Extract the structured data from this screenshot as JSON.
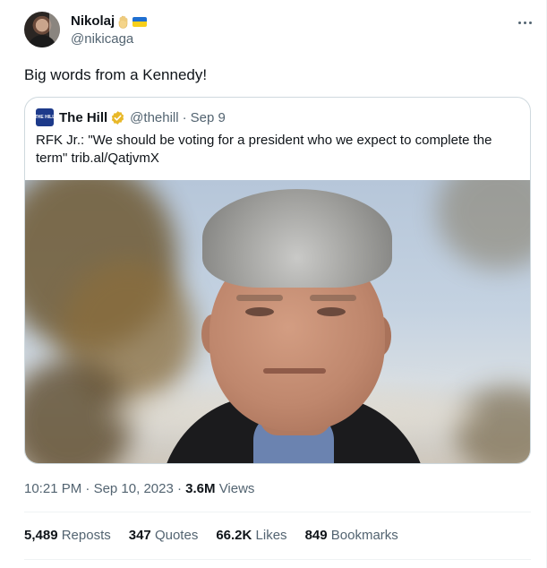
{
  "author": {
    "display_name": "Nikolaj",
    "handle": "@nikicaga"
  },
  "tweet": {
    "text": "Big words from a Kennedy!"
  },
  "quoted_tweet": {
    "logo_text": "THE HILL",
    "name": "The Hill",
    "handle": "@thehill",
    "separator": "·",
    "date": "Sep 9",
    "text": "RFK Jr.: \"We should be voting for a president who we expect to complete the term\" trib.al/QatjvmX"
  },
  "meta": {
    "time": "10:21 PM",
    "separator": "·",
    "date": "Sep 10, 2023",
    "views_count": "3.6M",
    "views_label": "Views"
  },
  "stats": [
    {
      "count": "5,489",
      "label": "Reposts"
    },
    {
      "count": "347",
      "label": "Quotes"
    },
    {
      "count": "66.2K",
      "label": "Likes"
    },
    {
      "count": "849",
      "label": "Bookmarks"
    }
  ],
  "colors": {
    "verified_gold": "#e8b829",
    "secondary_text": "#536471",
    "flag_blue": "#1f6fd1",
    "flag_yellow": "#f7cf1b"
  },
  "icons": {
    "more": "more-icon",
    "verified": "verified-badge-icon",
    "hand": "raised-hand-icon",
    "flag": "ukraine-flag-icon"
  }
}
